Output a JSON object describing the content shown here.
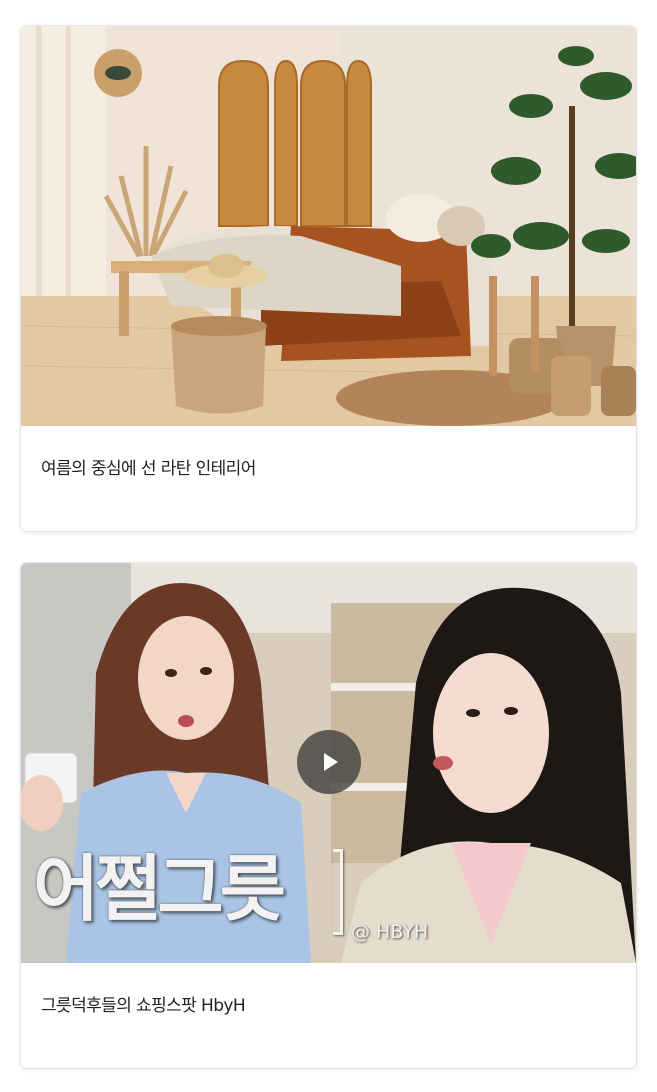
{
  "cards": [
    {
      "title": "여름의 중심에 선 라탄 인테리어",
      "type": "image"
    },
    {
      "title": "그릇덕후들의 쇼핑스팟 HbyH",
      "type": "video",
      "overlay_title": "어쩔그릇",
      "overlay_handle": "@ HBYH"
    }
  ],
  "colors": {
    "card_background": "#ffffff",
    "title_text": "#222222",
    "play_button": "#3c3c3c"
  }
}
